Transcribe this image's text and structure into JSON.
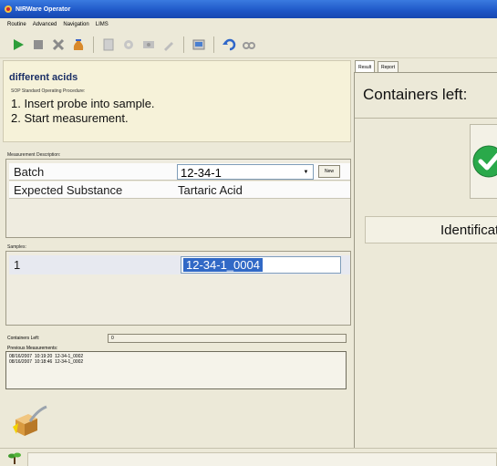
{
  "window": {
    "title": "NIRWare Operator"
  },
  "menu": [
    "Routine",
    "Advanced",
    "Navigation",
    "LIMS"
  ],
  "toolbar": {
    "icons": [
      "play-icon",
      "stop-icon",
      "cancel-icon",
      "sample-bag-icon",
      "document-icon",
      "settings-icon",
      "configure-icon",
      "tools-icon",
      "export-icon",
      "undo-icon",
      "view-icon"
    ]
  },
  "procedure": {
    "title": "different acids",
    "sop_label": "SOP Standard Operating Procedure:",
    "steps": [
      "1. Insert probe into sample.",
      "2. Start measurement."
    ]
  },
  "measurement_description": {
    "label": "Measurement Description:",
    "batch_label": "Batch",
    "batch_value": "12-34-1",
    "new_button": "New",
    "substance_label": "Expected Substance",
    "substance_value": "Tartaric Acid"
  },
  "samples": {
    "label": "Samples:",
    "row_number": "1",
    "sample_id": "12-34-1_0004"
  },
  "containers": {
    "label": "Containers Left:",
    "value": "0"
  },
  "previous": {
    "label": "Previous Measurements:",
    "rows": [
      {
        "date": "08/16/2007",
        "time": "10:19:20",
        "id": "12-34-1_0002"
      },
      {
        "date": "08/16/2007",
        "time": "10:18:46",
        "id": "12-34-1_0002"
      }
    ]
  },
  "right_panel": {
    "tabs": [
      "Result",
      "Report"
    ],
    "containers_title": "Containers left:",
    "identify_button": "Identification"
  },
  "colors": {
    "titlebar": "#1e56c6",
    "sop_panel": "#f6f2d9",
    "procedure_title": "#1b2f66",
    "selection": "#3169c6",
    "ok_green": "#2aa94a"
  }
}
